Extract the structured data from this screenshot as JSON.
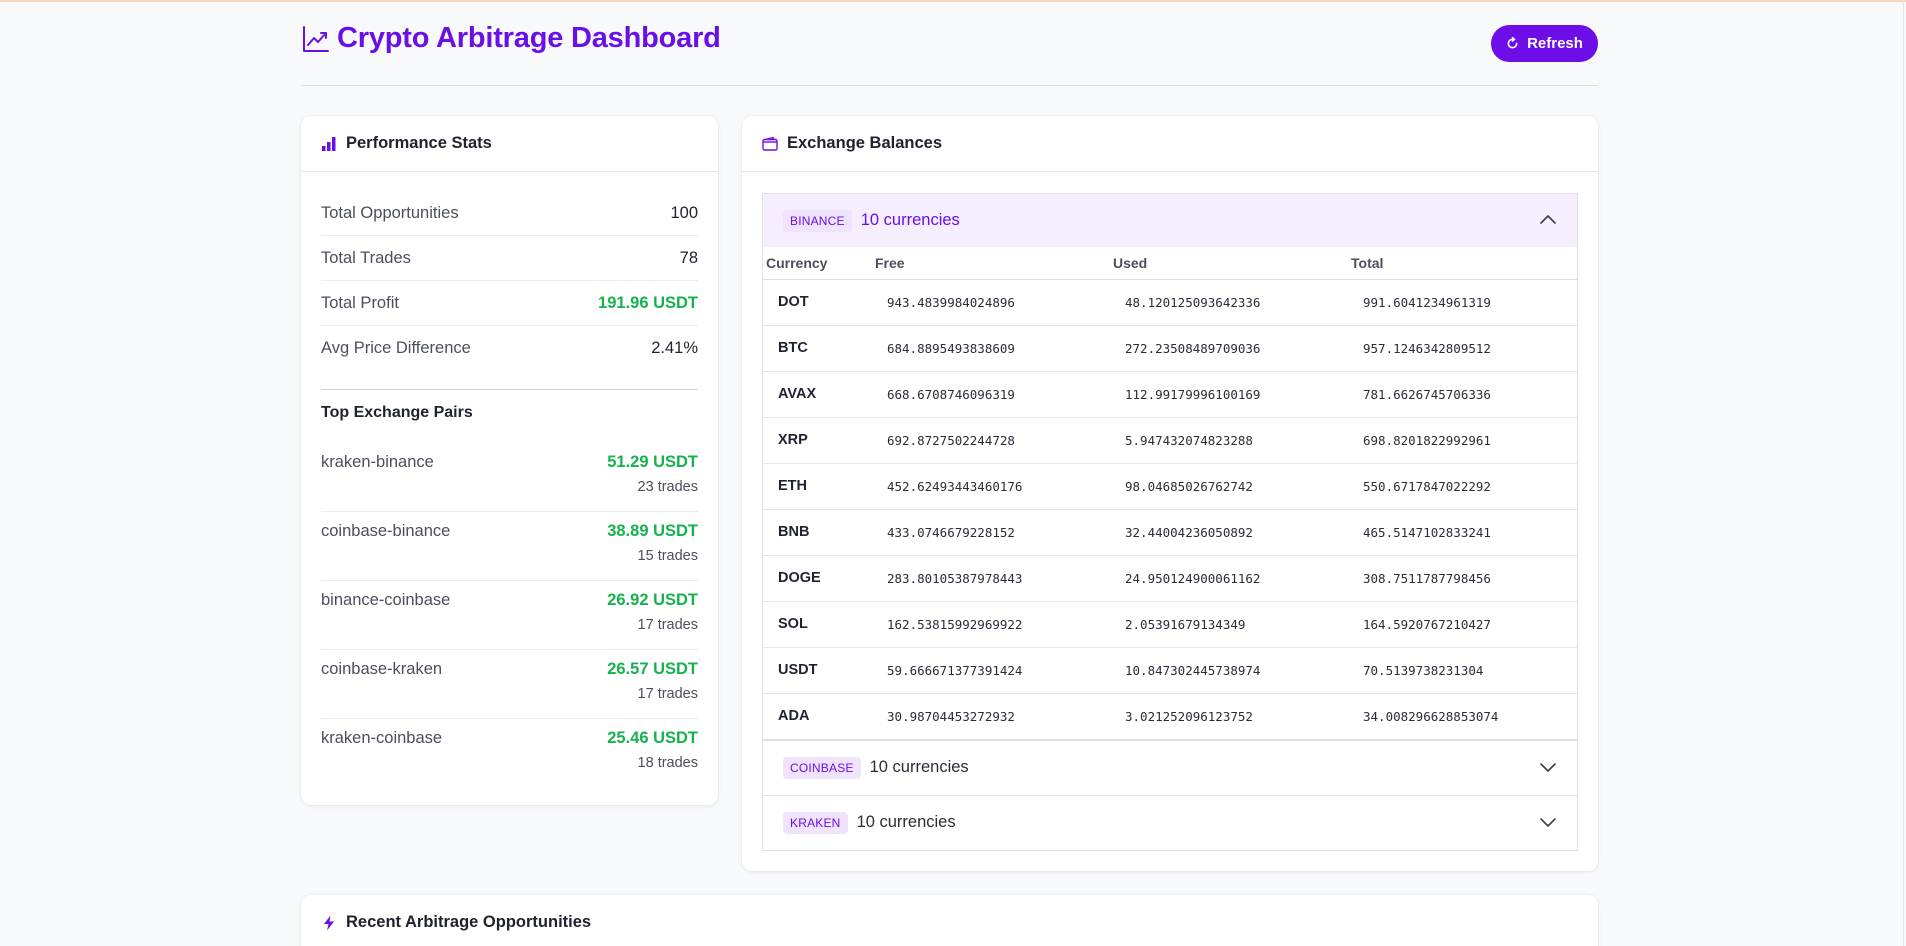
{
  "header": {
    "title": "Crypto Arbitrage Dashboard",
    "refresh_label": "Refresh"
  },
  "performance": {
    "title": "Performance Stats",
    "stats": [
      {
        "label": "Total Opportunities",
        "value": "100",
        "positive": false
      },
      {
        "label": "Total Trades",
        "value": "78",
        "positive": false
      },
      {
        "label": "Total Profit",
        "value": "191.96 USDT",
        "positive": true
      },
      {
        "label": "Avg Price Difference",
        "value": "2.41%",
        "positive": false
      }
    ],
    "pairs_title": "Top Exchange Pairs",
    "pairs": [
      {
        "name": "kraken-binance",
        "profit": "51.29 USDT",
        "trades": "23 trades"
      },
      {
        "name": "coinbase-binance",
        "profit": "38.89 USDT",
        "trades": "15 trades"
      },
      {
        "name": "binance-coinbase",
        "profit": "26.92 USDT",
        "trades": "17 trades"
      },
      {
        "name": "coinbase-kraken",
        "profit": "26.57 USDT",
        "trades": "17 trades"
      },
      {
        "name": "kraken-coinbase",
        "profit": "25.46 USDT",
        "trades": "18 trades"
      }
    ]
  },
  "balances": {
    "title": "Exchange Balances",
    "columns": [
      "Currency",
      "Free",
      "Used",
      "Total"
    ],
    "exchanges": [
      {
        "badge": "BINANCE",
        "count": "10 currencies",
        "expanded": true,
        "rows": [
          [
            "DOT",
            "943.4839984024896",
            "48.120125093642336",
            "991.6041234961319"
          ],
          [
            "BTC",
            "684.8895493838609",
            "272.23508489709036",
            "957.1246342809512"
          ],
          [
            "AVAX",
            "668.6708746096319",
            "112.99179996100169",
            "781.6626745706336"
          ],
          [
            "XRP",
            "692.8727502244728",
            "5.947432074823288",
            "698.8201822992961"
          ],
          [
            "ETH",
            "452.62493443460176",
            "98.04685026762742",
            "550.6717847022292"
          ],
          [
            "BNB",
            "433.0746679228152",
            "32.44004236050892",
            "465.5147102833241"
          ],
          [
            "DOGE",
            "283.80105387978443",
            "24.950124900061162",
            "308.7511787798456"
          ],
          [
            "SOL",
            "162.53815992969922",
            "2.05391679134349",
            "164.5920767210427"
          ],
          [
            "USDT",
            "59.666671377391424",
            "10.847302445738974",
            "70.5139738231304"
          ],
          [
            "ADA",
            "30.98704453272932",
            "3.021252096123752",
            "34.008296628853074"
          ]
        ]
      },
      {
        "badge": "COINBASE",
        "count": "10 currencies",
        "expanded": false,
        "rows": []
      },
      {
        "badge": "KRAKEN",
        "count": "10 currencies",
        "expanded": false,
        "rows": []
      }
    ]
  },
  "recent": {
    "title": "Recent Arbitrage Opportunities"
  },
  "colors": {
    "accent": "#6d0de8",
    "profit_green": "#16b24e",
    "badge_bg": "#efe3fd"
  }
}
